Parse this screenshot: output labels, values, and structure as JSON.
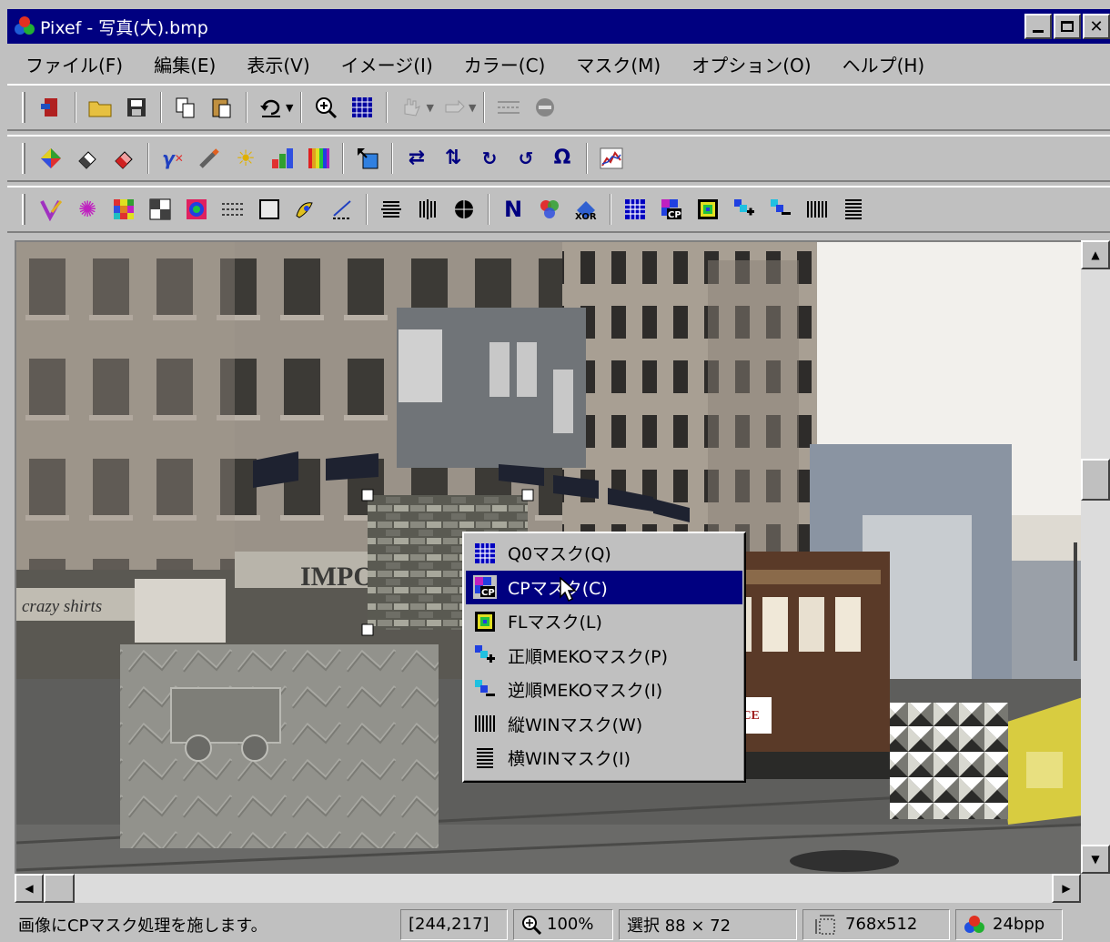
{
  "window": {
    "title": "Pixef - 写真(大).bmp",
    "buttons": [
      "_",
      "□",
      "X"
    ]
  },
  "menubar": [
    "ファイル(F)",
    "編集(E)",
    "表示(V)",
    "イメージ(I)",
    "カラー(C)",
    "マスク(M)",
    "オプション(O)",
    "ヘルプ(H)"
  ],
  "toolbar1": [
    "exit-icon",
    "open-folder-icon",
    "save-icon",
    "copy-icon",
    "paste-icon",
    "undo-icon",
    "zoom-icon",
    "grid-icon",
    "hand-icon",
    "pointer-icon",
    "line-icon",
    "stop-icon"
  ],
  "toolbar2": [
    "color-icon",
    "eraser-icon",
    "eraser2-icon",
    "gamma-icon",
    "pen-icon",
    "brightness-icon",
    "rgb-icon",
    "palette-icon",
    "resize-icon",
    "flip-h-icon",
    "flip-v-icon",
    "rotate-90-icon",
    "rotate-ccw-90-icon",
    "rotate-180-icon",
    "histogram-icon"
  ],
  "toolbar3": [
    "brush-icon",
    "star-icon",
    "mosaic-icon",
    "checker-icon",
    "spiral-icon",
    "stripes-icon",
    "frame-icon",
    "paint-icon",
    "pen2-icon",
    "center-h-icon",
    "center-v-icon",
    "center-icon",
    "n-icon",
    "color-wheel-icon",
    "xor-icon",
    "q0-mask-icon",
    "cp-mask-icon",
    "fl-mask-icon",
    "meko-plus-icon",
    "meko-minus-icon",
    "vwin-icon",
    "hwin-icon"
  ],
  "context_menu": {
    "items": [
      {
        "label": "Q0マスク(Q)",
        "icon": "q0-mask-icon"
      },
      {
        "label": "CPマスク(C)",
        "icon": "cp-mask-icon",
        "selected": true
      },
      {
        "label": "FLマスク(L)",
        "icon": "fl-mask-icon"
      },
      {
        "label": "正順MEKOマスク(P)",
        "icon": "meko-plus-icon"
      },
      {
        "label": "逆順MEKOマスク(I)",
        "icon": "meko-minus-icon"
      },
      {
        "label": "縦WINマスク(W)",
        "icon": "vwin-icon"
      },
      {
        "label": "横WINマスク(I)",
        "icon": "hwin-icon"
      }
    ]
  },
  "image_signs": {
    "store": "IMPOSTO",
    "shop": "crazy shirts",
    "tram": "ICE"
  },
  "status": {
    "message": "画像にCPマスク処理を施します。",
    "coords": "[244,217]",
    "zoom": "100%",
    "selection": "選択 88 × 72",
    "size": "768x512",
    "depth": "24bpp"
  }
}
